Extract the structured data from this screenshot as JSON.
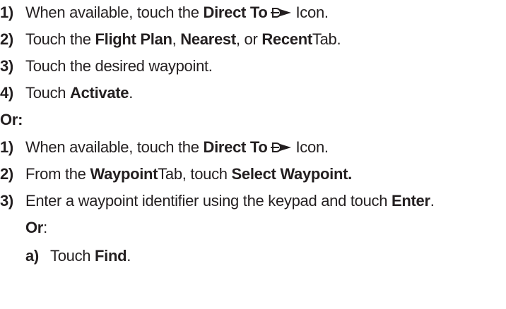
{
  "procedure_a": [
    {
      "num": "1)",
      "pre": "When available, touch the ",
      "b1": "Direct To",
      "post": "Icon."
    },
    {
      "num": "2)",
      "pre": "Touch the ",
      "b1": "Flight Plan",
      "mid1": ", ",
      "b2": "Nearest",
      "mid2": ", or ",
      "b3": "Recent",
      "post": " Tab."
    },
    {
      "num": "3)",
      "text": "Touch the desired waypoint."
    },
    {
      "num": "4)",
      "pre": "Touch ",
      "b1": "Activate",
      "post": "."
    }
  ],
  "or_main": "Or:",
  "procedure_b": [
    {
      "num": "1)",
      "pre": "When available, touch the ",
      "b1": "Direct To",
      "post": "Icon."
    },
    {
      "num": "2)",
      "pre": "From the ",
      "b1": "Waypoint",
      "mid1": " Tab, touch ",
      "b2": "Select Waypoint."
    },
    {
      "num": "3)",
      "pre": "Enter a waypoint identifier using the keypad and touch ",
      "b1": "Enter",
      "post": "."
    }
  ],
  "or_sub": "Or",
  "or_sub_colon": ":",
  "sub_step": {
    "num": "a)",
    "pre": "Touch ",
    "b1": "Find",
    "post": "."
  },
  "icon": "direct-to-icon"
}
